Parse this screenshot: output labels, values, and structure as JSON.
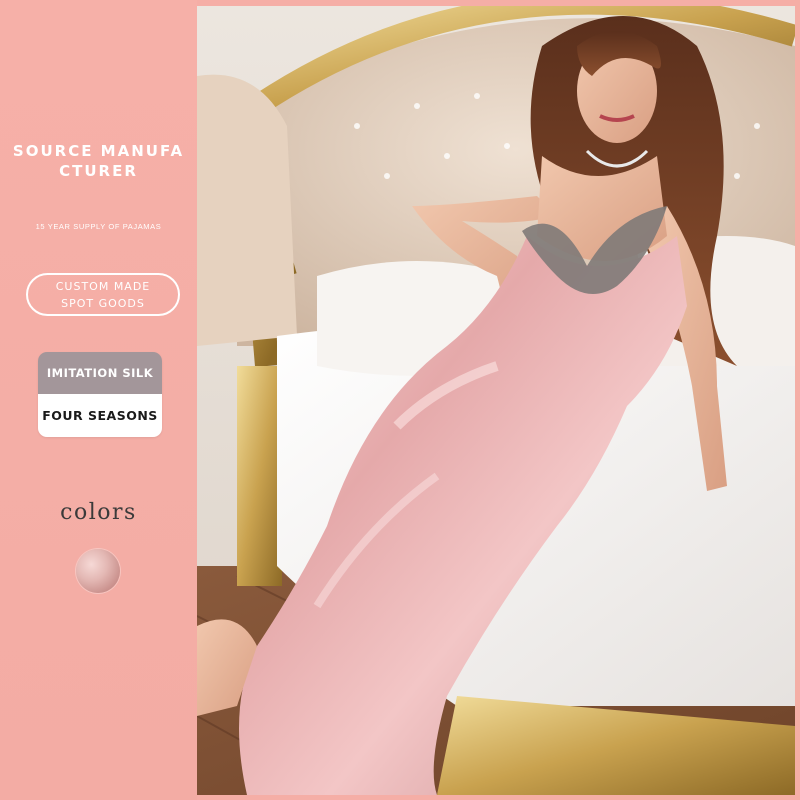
{
  "sidebar": {
    "title_line1": "SOURCE MANUFA",
    "title_line2": "CTURER",
    "subtitle": "15 YEAR SUPPLY OF PAJAMAS",
    "pill_line1": "CUSTOM MADE",
    "pill_line2": "SPOT GOODS",
    "tag_top": "IMITATION SILK",
    "tag_bottom": "FOUR SEASONS",
    "colors_label": "colors",
    "swatch_color": "#e4b8b4"
  },
  "colors": {
    "background": "#f5aea6",
    "tag_gray": "#a3969a",
    "text_white": "#ffffff"
  }
}
